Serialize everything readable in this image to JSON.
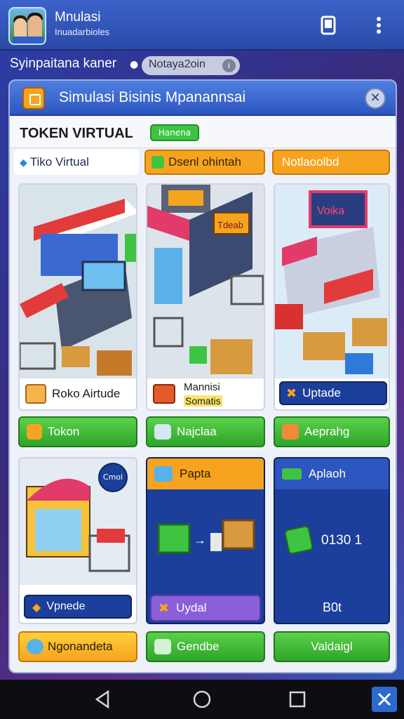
{
  "app": {
    "title": "Mnulasi",
    "subtitle": "Inuadarbioles"
  },
  "subbar": {
    "text": "Syinpaitana kaner",
    "pill": "Notaya2oin",
    "pill_icon": "info-icon"
  },
  "panel": {
    "title": "Simulasi Bisinis Mpanannsai"
  },
  "token": {
    "title": "TOKEN VIRTUAL",
    "badge": "Hanena"
  },
  "tabs": [
    {
      "label": "Tiko Virtual",
      "icon": "diamond-icon"
    },
    {
      "label": "Dsenl ohintah",
      "icon": "leaf-icon"
    },
    {
      "label": "Notlaoolbd",
      "icon": ""
    }
  ],
  "cards_top": [
    {
      "label": "Roko Airtude",
      "icon": "cart-icon"
    },
    {
      "label_line1": "Mannisi",
      "label_line2": "Somatis",
      "icon": "cart-icon"
    },
    {
      "label": "Uptade",
      "icon": "wrench-icon"
    }
  ],
  "store_signs": {
    "center": "Tdeab",
    "right": "Voika"
  },
  "buttons_row1": [
    {
      "label": "Tokon",
      "icon": "puzzle-icon"
    },
    {
      "label": "Najclaa",
      "icon": "puzzle-icon"
    },
    {
      "label": "Aeprahg",
      "icon": "tools-icon"
    }
  ],
  "cards_bottom": {
    "left": {
      "badge": "Cmol",
      "button": "Vpnede",
      "icon": "chevron-icon"
    },
    "middle": {
      "header": "Papta",
      "button": "Uydal",
      "icon": "crossed-tools-icon"
    },
    "right": {
      "header": "Aplaoh",
      "value": "0130 1",
      "footer": "B0t"
    }
  },
  "buttons_row2": [
    {
      "label": "Ngonandeta",
      "icon": "chat-icon"
    },
    {
      "label": "Gendbe",
      "icon": "chat-icon"
    },
    {
      "label": "Valdaigl"
    }
  ],
  "colors": {
    "green": "#3ec442",
    "orange": "#f6a41f",
    "navy": "#1b3f9a",
    "purple": "#8a5fd9"
  },
  "nav": [
    "back-icon",
    "home-icon",
    "recents-icon",
    "tools-icon"
  ]
}
